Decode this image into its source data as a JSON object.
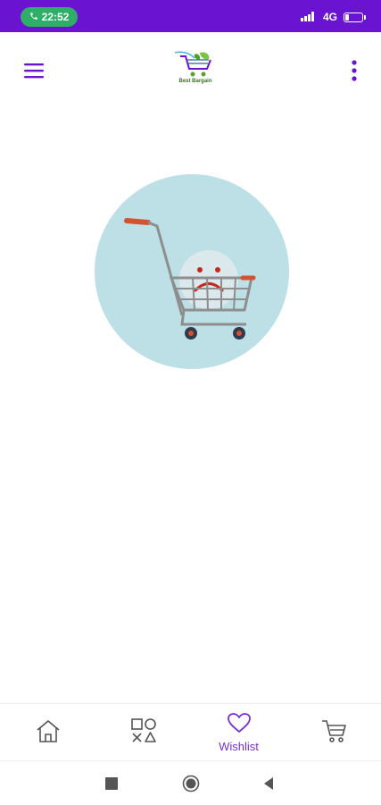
{
  "status_bar": {
    "time": "22:52",
    "network": "4G",
    "battery_text": "23",
    "battery_level": 0.23
  },
  "app_bar": {
    "logo_text": "Best Bargain",
    "menu_icon": "hamburger-menu-icon",
    "more_icon": "more-vertical-icon"
  },
  "empty_state": {
    "illustration": "sad-face-shopping-cart"
  },
  "bottom_nav": {
    "items": [
      {
        "label": "",
        "icon": "home-icon",
        "active": false
      },
      {
        "label": "",
        "icon": "categories-icon",
        "active": false
      },
      {
        "label": "Wishlist",
        "icon": "heart-icon",
        "active": true
      },
      {
        "label": "",
        "icon": "cart-icon",
        "active": false
      }
    ]
  },
  "colors": {
    "primary": "#6a14d1",
    "accent": "#7a2fd6",
    "call_pill": "#2fae68",
    "circle_bg": "#bde0e6"
  }
}
